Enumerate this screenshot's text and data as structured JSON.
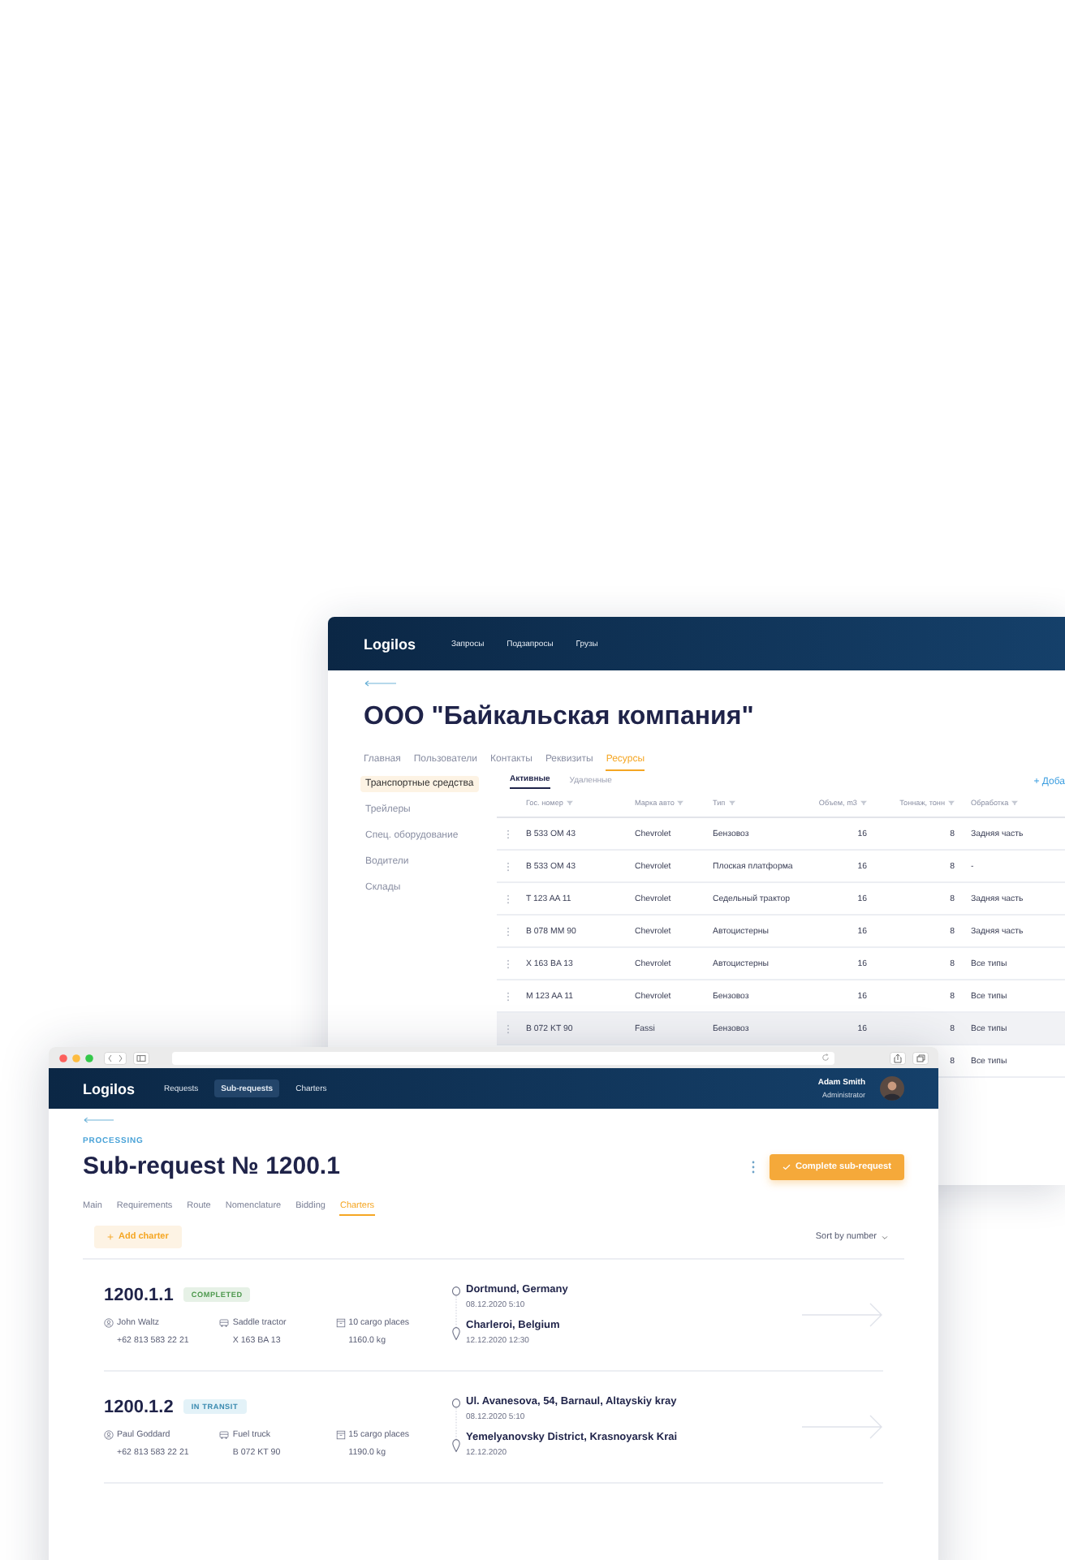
{
  "back_window": {
    "logo": "Logilos",
    "nav": [
      "Запросы",
      "Подзапросы",
      "Грузы"
    ],
    "title": "ООО \"Байкальская компания\"",
    "tabs": [
      {
        "label": "Главная",
        "selected": false
      },
      {
        "label": "Пользователи",
        "selected": false
      },
      {
        "label": "Контакты",
        "selected": false
      },
      {
        "label": "Реквизиты",
        "selected": false
      },
      {
        "label": "Ресурсы",
        "selected": true
      }
    ],
    "sidebar": {
      "items": [
        {
          "label": "Транспортные средства",
          "selected": true
        },
        {
          "label": "Трейлеры",
          "selected": false
        },
        {
          "label": "Спец. оборудование",
          "selected": false
        },
        {
          "label": "Водители",
          "selected": false
        },
        {
          "label": "Склады",
          "selected": false
        }
      ]
    },
    "subtabs": [
      {
        "label": "Активные",
        "selected": true
      },
      {
        "label": "Удаленные",
        "selected": false
      }
    ],
    "add_button": "+ Доба",
    "table": {
      "columns": [
        "Гос. номер",
        "Марка авто",
        "Тип",
        "Объем, m3",
        "Тоннаж, тонн",
        "Обработка"
      ],
      "rows": [
        {
          "plate": "B 533 OM 43",
          "brand": "Chevrolet",
          "type": "Бензовоз",
          "volume": "16",
          "tonnage": "8",
          "processing": "Задняя часть",
          "highlighted": false
        },
        {
          "plate": "B 533 OM 43",
          "brand": "Chevrolet",
          "type": "Плоская платформа",
          "volume": "16",
          "tonnage": "8",
          "processing": "-",
          "highlighted": false
        },
        {
          "plate": "T 123 AA 11",
          "brand": "Chevrolet",
          "type": "Седельный трактор",
          "volume": "16",
          "tonnage": "8",
          "processing": "Задняя часть",
          "highlighted": false
        },
        {
          "plate": "B 078 MM 90",
          "brand": "Chevrolet",
          "type": "Автоцистерны",
          "volume": "16",
          "tonnage": "8",
          "processing": "Задняя часть",
          "highlighted": false
        },
        {
          "plate": "X 163 BA 13",
          "brand": "Chevrolet",
          "type": "Автоцистерны",
          "volume": "16",
          "tonnage": "8",
          "processing": "Все типы",
          "highlighted": false
        },
        {
          "plate": "M 123 AA 11",
          "brand": "Chevrolet",
          "type": "Бензовоз",
          "volume": "16",
          "tonnage": "8",
          "processing": "Все типы",
          "highlighted": false
        },
        {
          "plate": "B 072 KT 90",
          "brand": "Fassi",
          "type": "Бензовоз",
          "volume": "16",
          "tonnage": "8",
          "processing": "Все типы",
          "highlighted": true
        },
        {
          "tonnage": "8",
          "processing": "Все типы",
          "highlighted": false
        }
      ]
    }
  },
  "front_window": {
    "logo": "Logilos",
    "nav": [
      {
        "label": "Requests",
        "selected": false
      },
      {
        "label": "Sub-requests",
        "selected": true
      },
      {
        "label": "Charters",
        "selected": false
      }
    ],
    "user": {
      "name": "Adam Smith",
      "role": "Administrator"
    },
    "status": "PROCESSING",
    "title": "Sub-request № 1200.1",
    "complete_button": "Complete sub-request",
    "tabs": [
      {
        "label": "Main",
        "selected": false
      },
      {
        "label": "Requirements",
        "selected": false
      },
      {
        "label": "Route",
        "selected": false
      },
      {
        "label": "Nomenclature",
        "selected": false
      },
      {
        "label": "Bidding",
        "selected": false
      },
      {
        "label": "Charters",
        "selected": true
      }
    ],
    "add_button": "Add charter",
    "sort": "Sort by number",
    "charters": [
      {
        "number": "1200.1.1",
        "status": {
          "label": "COMPLETED",
          "kind": "completed"
        },
        "driver": "John Waltz",
        "phone": "+62 813 583 22 21",
        "vehicle": "Saddle tractor",
        "plate": "X 163 BA 13",
        "places": "10 cargo places",
        "weight": "1160.0 kg",
        "from": {
          "place": "Dortmund, Germany",
          "date": "08.12.2020 5:10"
        },
        "to": {
          "place": "Charleroi, Belgium",
          "date": "12.12.2020 12:30"
        }
      },
      {
        "number": "1200.1.2",
        "status": {
          "label": "IN TRANSIT",
          "kind": "in_transit"
        },
        "driver": "Paul Goddard",
        "phone": "+62 813 583 22 21",
        "vehicle": "Fuel truck",
        "plate": "B 072 KT 90",
        "places": "15 cargo places",
        "weight": "1190.0 kg",
        "from": {
          "place": "Ul. Avanesova, 54, Barnaul, Altayskiy kray",
          "date": "08.12.2020 5:10"
        },
        "to": {
          "place": "Yemelyanovsky District, Krasnoyarsk Krai",
          "date": "12.12.2020"
        }
      }
    ]
  }
}
